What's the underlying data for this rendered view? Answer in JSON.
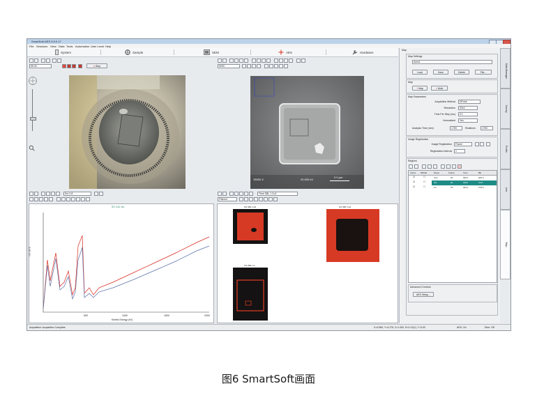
{
  "window": {
    "title": "SmartSoft-AES 5.6.0.17"
  },
  "menu": [
    "File",
    "Sessions",
    "View",
    "Data",
    "Tools",
    "Automation",
    "User Level",
    "Help"
  ],
  "nav": {
    "system": "System",
    "sample": "Sample",
    "sem": "SEM",
    "aes": "AES",
    "hardware": "Hardware"
  },
  "sample_pane": {
    "dropdown": "55.00",
    "stop_label": "Stop"
  },
  "sem_pane": {
    "dropdown": "5000",
    "magnification": "15000 X",
    "voltage": "20.000 kV",
    "scale_bar": "2.0 μm"
  },
  "spectrum_pane": {
    "dropdown": "Sur 0.8",
    "title": "Si1 C&L cts",
    "ylabel": "c/s·10^3",
    "xlabel": "Kinetic Energy (eV)",
    "xticks": [
      "500",
      "1000",
      "1500",
      "2000"
    ]
  },
  "map_pane": {
    "dropdown_left": "Filtered",
    "dropdown_right": "Time SBL 1 Cu2",
    "map1_title": "Si1 SBL Cu2",
    "map2_title": "Si1 SBL Cu2",
    "map3_title": "Si1 SBL Cu"
  },
  "right_panel": {
    "header": "Map",
    "map_settings": {
      "title": "Map Settings",
      "value": "Area1",
      "buttons": [
        "Load",
        "Save",
        "Delete",
        "File..."
      ]
    },
    "map_section": {
      "title": "Map",
      "buttons": [
        "Map",
        "Mole"
      ]
    },
    "map_parameters": {
      "title": "Map Parameters",
      "rows": [
        {
          "label": "Acquisition Method",
          "value": "DPoint"
        },
        {
          "label": "Resolution",
          "value": "32x4"
        },
        {
          "label": "Time Per Step (ms)",
          "value": "0.1"
        },
        {
          "label": "Normalized",
          "value": "Yes"
        }
      ],
      "analysis_time_label": "Analysis Time (mm)",
      "analysis_time": "1783",
      "rotations_label": "Rotations",
      "rotations": "1783"
    },
    "image_registration": {
      "title": "Image Registration",
      "row1_label": "Image Registration",
      "row1_value": "Frame",
      "row2_label": "Registration Interval",
      "row2_value": "1"
    },
    "regions": {
      "title": "Regions",
      "columns": [
        "Active",
        "MDHD",
        "Name",
        "Frame",
        "Time",
        "BE"
      ],
      "rows": [
        {
          "name": "Cu2",
          "frame": "20",
          "time": "920.1",
          "be": "940.0"
        },
        {
          "name": "Si1",
          "frame": "20",
          "time": "1603",
          "be": "1617"
        },
        {
          "name": "C1",
          "frame": "15",
          "time": "264.1",
          "be": "278.6"
        }
      ]
    },
    "advanced": {
      "title": "Advanced Controls",
      "button": "AES Setup..."
    }
  },
  "side_tabs": [
    "Data Manager",
    "Survey",
    "Profile",
    "Line",
    "Map"
  ],
  "status": {
    "left": "Acquisition: Acquisition Complete.",
    "coords": "X=0.560, Y=4.275, Z=1.000, R=0.11(X), T=0.00",
    "aes": "AES: On",
    "ebm": "Ebm: Off"
  },
  "caption": "图6 SmartSoft画面",
  "colors": {
    "red": "#d9251b",
    "blue": "#5b6fa8",
    "map_red": "#d73a24"
  }
}
